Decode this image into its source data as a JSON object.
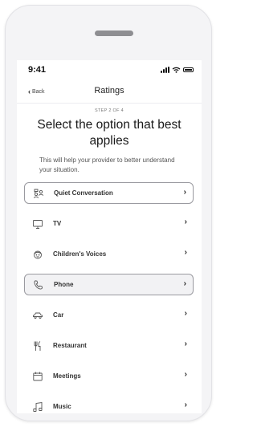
{
  "status_bar": {
    "time": "9:41"
  },
  "nav": {
    "back_label": "Back",
    "title": "Ratings"
  },
  "step_label": "STEP 2 OF 4",
  "title": "Select the option that best applies",
  "subtitle": "This will help your provider to better understand your situation.",
  "options": [
    {
      "label": "Quiet Conversation",
      "icon": "people-talking-icon"
    },
    {
      "label": "TV",
      "icon": "tv-icon"
    },
    {
      "label": "Children's Voices",
      "icon": "child-face-icon"
    },
    {
      "label": "Phone",
      "icon": "phone-icon"
    },
    {
      "label": "Car",
      "icon": "car-icon"
    },
    {
      "label": "Restaurant",
      "icon": "fork-knife-icon"
    },
    {
      "label": "Meetings",
      "icon": "calendar-icon"
    },
    {
      "label": "Music",
      "icon": "music-note-icon"
    }
  ],
  "colors": {
    "accent_text": "#222222",
    "border": "#9a9aa0",
    "highlight_bg": "#f2f2f4"
  }
}
